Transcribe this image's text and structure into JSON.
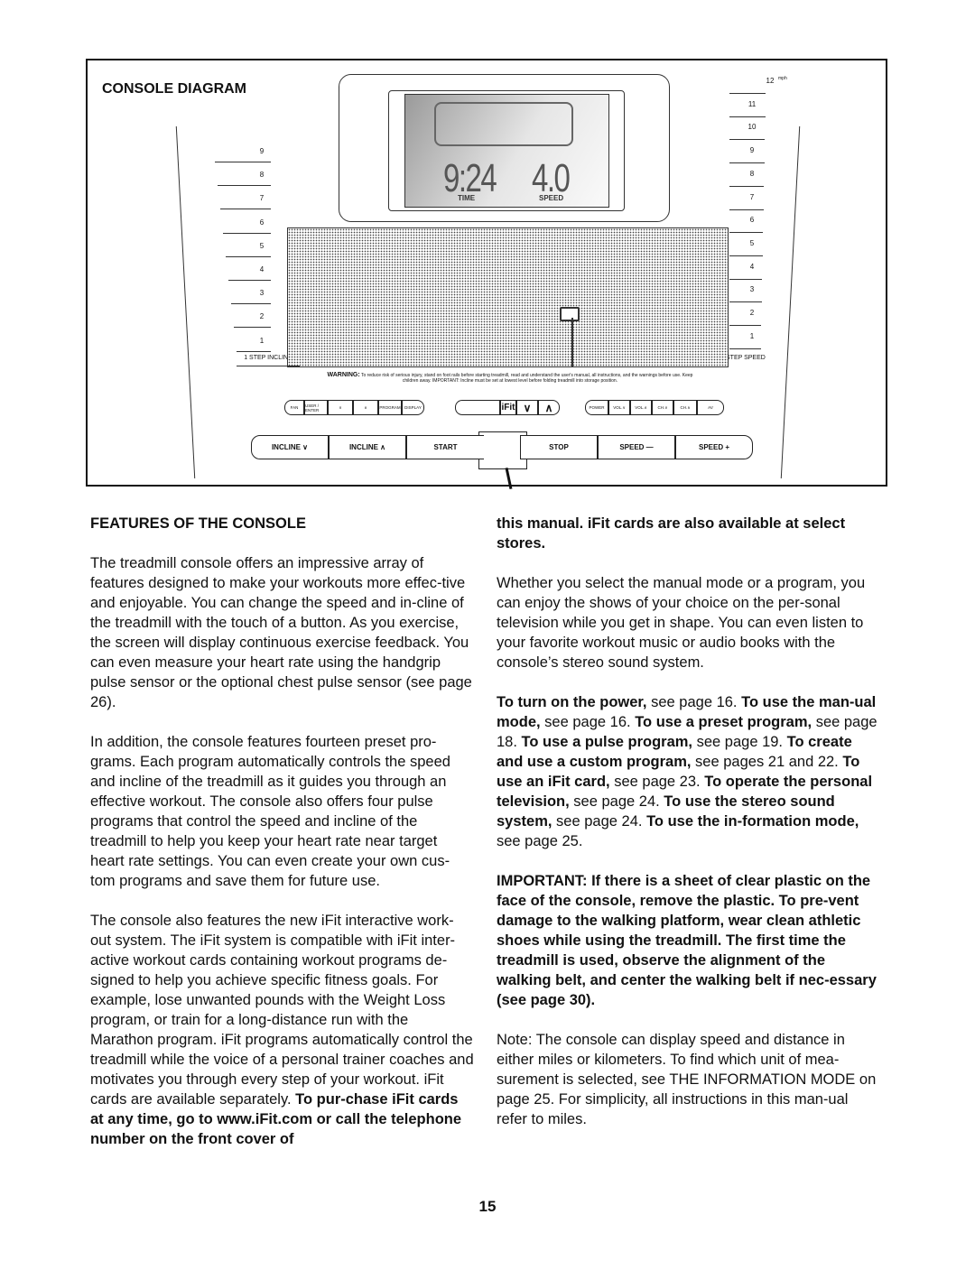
{
  "diagram": {
    "title": "CONSOLE DIAGRAM",
    "incline_scale": [
      "9",
      "8",
      "7",
      "6",
      "5",
      "4",
      "3",
      "2",
      "1"
    ],
    "incline_label": "1 STEP INCLINE",
    "speed_scale": [
      "12",
      "11",
      "10",
      "9",
      "8",
      "7",
      "6",
      "5",
      "4",
      "3",
      "2",
      "1"
    ],
    "speed_unit": "mph",
    "speed_label": "1 STEP SPEED",
    "display": {
      "time": "9:24",
      "time_label": "TIME",
      "speed": "4.0",
      "speed_label": "SPEED"
    },
    "warning_title": "WARNING:",
    "warning_text": "To reduce risk of serious injury, stand on foot rails before starting treadmill, read and understand the user's manual, all instructions, and the warnings before use. Keep children away. IMPORTANT: Incline must be set at lowest level before folding treadmill into storage position.",
    "small_buttons_left": [
      "FAN",
      "USER / ENTER",
      "∨",
      "∧",
      "PROGRAM",
      "DISPLAY"
    ],
    "ifit_buttons": [
      "iFit",
      "∨",
      "∧"
    ],
    "small_buttons_right": [
      "POWER",
      "VOL.∨",
      "VOL.∧",
      "CH.∨",
      "CH.∧",
      "AV"
    ],
    "large_buttons": [
      "INCLINE ∨",
      "INCLINE ∧",
      "START",
      "STOP",
      "SPEED —",
      "SPEED +"
    ]
  },
  "left_column": {
    "heading": "FEATURES OF THE CONSOLE",
    "paragraphs": [
      [
        {
          "t": "The treadmill console offers an impressive array of features designed to make your workouts more effec-tive and enjoyable. You can change the speed and in-cline of the treadmill with the touch of a button. As you exercise, the screen will display continuous exercise feedback. You can even measure your heart rate using the handgrip pulse sensor or the optional chest pulse sensor (see page 26).",
          "b": false
        }
      ],
      [
        {
          "t": "In addition, the console features fourteen preset pro-grams. Each program automatically controls the speed and incline of the treadmill as it guides you through an effective workout. The console also offers four pulse programs that control the speed and incline of the treadmill to help you keep your heart rate near target heart rate settings. You can even create your own cus-tom programs and save them for future use.",
          "b": false
        }
      ],
      [
        {
          "t": "The console also features the new iFit interactive work-out system. The iFit system is compatible with iFit inter-active workout cards containing workout programs de-signed to help you achieve specific fitness goals. For example, lose unwanted pounds with the Weight Loss program, or train for a long-distance run with the Marathon program. iFit programs automatically control the treadmill while the voice of a personal trainer coaches and motivates you through every step of your workout. iFit cards are available separately. ",
          "b": false
        },
        {
          "t": "To pur-chase iFit cards at any time, go to www.iFit.com or call the telephone number on the front cover of",
          "b": true
        }
      ]
    ]
  },
  "right_column": {
    "paragraphs": [
      [
        {
          "t": "this manual. iFit cards are also available at select stores.",
          "b": true
        }
      ],
      [
        {
          "t": "Whether you select the manual mode or a program, you can enjoy the shows of your choice on the per-sonal television while you get in shape. You can even listen to your favorite workout music or audio books with the console’s stereo sound system.",
          "b": false
        }
      ],
      [
        {
          "t": "To turn on the power,",
          "b": true
        },
        {
          "t": " see page 16. ",
          "b": false
        },
        {
          "t": "To use the man-ual mode,",
          "b": true
        },
        {
          "t": " see page 16. ",
          "b": false
        },
        {
          "t": "To use a preset program,",
          "b": true
        },
        {
          "t": " see page 18. ",
          "b": false
        },
        {
          "t": "To use a pulse program,",
          "b": true
        },
        {
          "t": " see page 19. ",
          "b": false
        },
        {
          "t": "To create and use a custom program,",
          "b": true
        },
        {
          "t": " see pages 21 and 22. ",
          "b": false
        },
        {
          "t": "To use an iFit card,",
          "b": true
        },
        {
          "t": " see page 23. ",
          "b": false
        },
        {
          "t": "To operate the personal television,",
          "b": true
        },
        {
          "t": " see page 24. ",
          "b": false
        },
        {
          "t": "To use the stereo sound system,",
          "b": true
        },
        {
          "t": " see page 24. ",
          "b": false
        },
        {
          "t": "To use the in-formation mode,",
          "b": true
        },
        {
          "t": " see page 25.",
          "b": false
        }
      ],
      [
        {
          "t": "IMPORTANT: If there is a sheet of clear plastic on the face of the console, remove the plastic. To pre-vent damage to the walking platform, wear clean athletic shoes while using the treadmill. The first time the treadmill is used, observe the alignment of the walking belt, and center the walking belt if nec-essary (see page 30).",
          "b": true
        }
      ],
      [
        {
          "t": "Note: The console can display speed and distance in either miles or kilometers. To find which unit of mea-surement is selected, see THE INFORMATION MODE on page 25. For simplicity, all instructions in this man-ual refer to miles.",
          "b": false
        }
      ]
    ]
  },
  "page_number": "15"
}
